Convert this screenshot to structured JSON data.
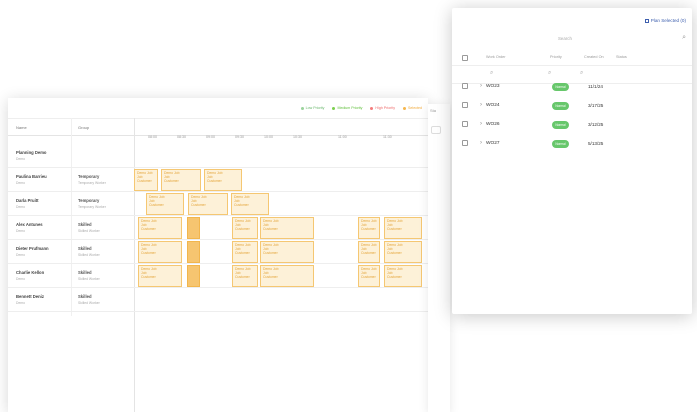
{
  "legend": [
    {
      "label": "Low Priority",
      "color": "#9ad39c"
    },
    {
      "label": "Medium Priority",
      "color": "#7ccf4f"
    },
    {
      "label": "High Priority",
      "color": "#f47c7c"
    },
    {
      "label": "Selected",
      "color": "#f5b64c"
    }
  ],
  "grid": {
    "name_header": "Name",
    "group_header": "Group",
    "times": [
      "08:00",
      "08:30",
      "09:00",
      "09:30",
      "10:00",
      "10:30",
      "11:00",
      "11:30"
    ]
  },
  "resources": [
    {
      "name": "Planning Demo",
      "sub": "Demo",
      "group": "",
      "group_sub": ""
    },
    {
      "name": "Paulina Barrieu",
      "sub": "Demo",
      "group": "Temporary",
      "group_sub": "Temporary Worker"
    },
    {
      "name": "Darla Pruitt",
      "sub": "Demo",
      "group": "Temporary",
      "group_sub": "Temporary Worker"
    },
    {
      "name": "Alex Antunes",
      "sub": "Demo",
      "group": "Skilled",
      "group_sub": "Skilled Worker"
    },
    {
      "name": "Dieter Prufmann",
      "sub": "Demo",
      "group": "Skilled",
      "group_sub": "Skilled Worker"
    },
    {
      "name": "Charlie Kellon",
      "sub": "Demo",
      "group": "Skilled",
      "group_sub": "Skilled Worker"
    },
    {
      "name": "Bennett Deniz",
      "sub": "Demo",
      "group": "Skilled",
      "group_sub": "Skilled Worker"
    }
  ],
  "block_text": {
    "title": "Demo Job",
    "line2": "Job",
    "line3": "Customer"
  },
  "side_tab": {
    "label": "Sta"
  },
  "plan_panel": {
    "plan_button": "Plan Selected (0)",
    "search_placeholder": "Search",
    "columns": [
      "Work Order",
      "Priority",
      "Created On",
      "Status"
    ],
    "rows": [
      {
        "wo": "WO23",
        "priority": "Normal",
        "date": "11/1/24"
      },
      {
        "wo": "WO24",
        "priority": "Normal",
        "date": "3/17/25"
      },
      {
        "wo": "WO26",
        "priority": "Normal",
        "date": "3/12/25"
      },
      {
        "wo": "WO27",
        "priority": "Normal",
        "date": "5/13/25"
      }
    ]
  },
  "icons": {
    "calendar": "calendar-icon",
    "search": "search-icon",
    "filter": "filter-search-icon",
    "expand": "chevron-right-icon"
  }
}
